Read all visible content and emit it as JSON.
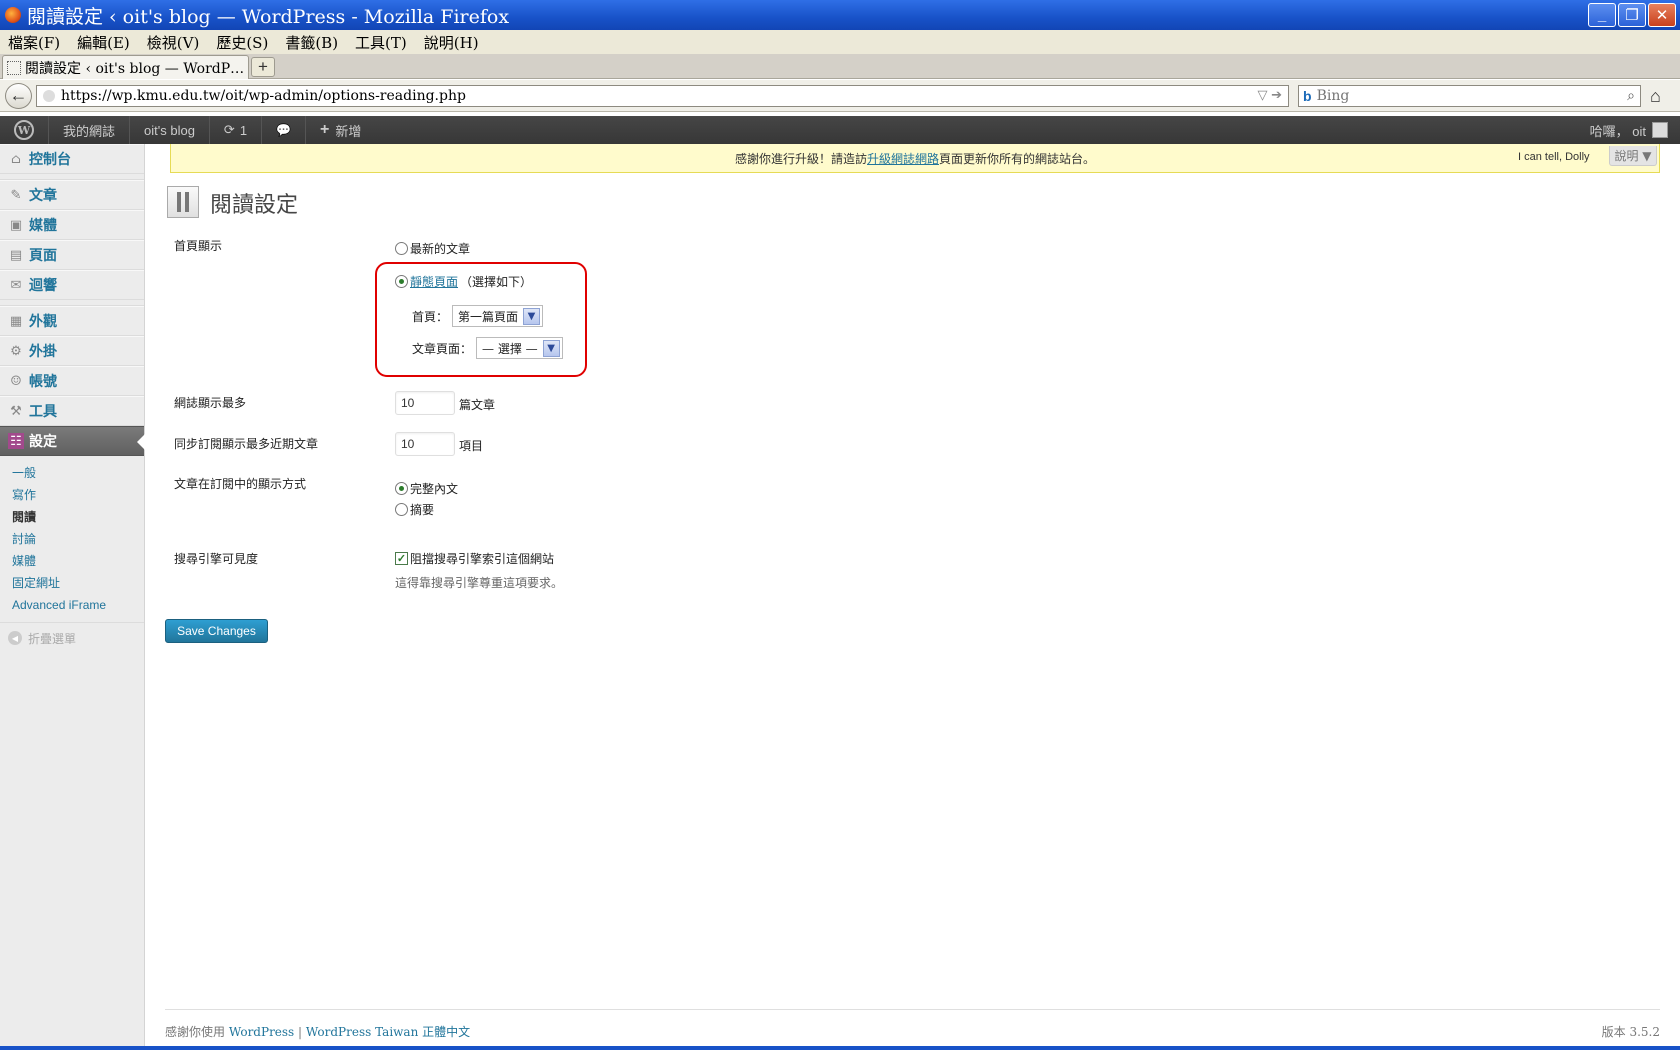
{
  "window": {
    "title": "閱讀設定 ‹ oit's blog — WordPress - Mozilla Firefox",
    "minimize": "_",
    "maximize": "❐",
    "close": "✕"
  },
  "menubar": [
    "檔案(F)",
    "編輯(E)",
    "檢視(V)",
    "歷史(S)",
    "書籤(B)",
    "工具(T)",
    "說明(H)"
  ],
  "tab": {
    "label": "閱讀設定 ‹ oit's blog — WordP…",
    "new_tab": "+"
  },
  "nav": {
    "back": "←",
    "url": "https://wp.kmu.edu.tw/oit/wp-admin/options-reading.php",
    "url_arrows": "▽ ➔",
    "search_engine": "b",
    "search_placeholder": "Bing",
    "search_icon": "⌕",
    "home_icon": "⌂"
  },
  "adminbar": {
    "wp_logo": "W",
    "my_sites": "我的網誌",
    "site_name": "oit's blog",
    "updates_icon": "⟳",
    "updates": "1",
    "comments_icon": "💬",
    "new_icon": "+",
    "new": "新增",
    "greeting": "哈囉， oit"
  },
  "sidebar": {
    "items": [
      {
        "icon": "⌂",
        "label": "控制台"
      },
      {
        "icon": "✎",
        "label": "文章"
      },
      {
        "icon": "▣",
        "label": "媒體"
      },
      {
        "icon": "▤",
        "label": "頁面"
      },
      {
        "icon": "✉",
        "label": "迴響"
      },
      {
        "icon": "▦",
        "label": "外觀"
      },
      {
        "icon": "⚙",
        "label": "外掛"
      },
      {
        "icon": "☺",
        "label": "帳號"
      },
      {
        "icon": "⚒",
        "label": "工具"
      },
      {
        "icon": "☷",
        "label": "設定"
      }
    ],
    "submenu": [
      "一般",
      "寫作",
      "閱讀",
      "討論",
      "媒體",
      "固定網址",
      "Advanced iFrame"
    ],
    "collapse_icon": "◀",
    "collapse": "折疊選單"
  },
  "notice": {
    "before": "感謝你進行升級！請造訪",
    "link": "升級網誌網路",
    "after": "頁面更新你所有的網誌站台。",
    "dolly": "I can tell, Dolly",
    "help": "說明 ▼"
  },
  "page": {
    "title": "閱讀設定",
    "front_page_label": "首頁顯示",
    "latest_posts": "最新的文章",
    "static_page_link": "靜態頁面",
    "static_page_hint": "（選擇如下）",
    "front_page_select_label": "首頁：",
    "front_page_select_value": "第一篇頁面",
    "posts_page_select_label": "文章頁面：",
    "posts_page_select_value": "— 選擇 —",
    "select_arrow": "▼",
    "blog_pages_label": "網誌顯示最多",
    "blog_pages_value": "10",
    "blog_pages_unit": "篇文章",
    "feed_label": "同步訂閱顯示最多近期文章",
    "feed_value": "10",
    "feed_unit": "項目",
    "feed_display_label": "文章在訂閱中的顯示方式",
    "full_text": "完整內文",
    "summary": "摘要",
    "search_visibility_label": "搜尋引擎可見度",
    "discourage_label": "阻擋搜尋引擎索引這個網站",
    "discourage_desc": "這得靠搜尋引擎尊重這項要求。",
    "checkmark": "✓",
    "save": "Save Changes"
  },
  "footer": {
    "thanks": "感謝你使用 ",
    "wordpress": "WordPress",
    "sep": " | ",
    "wp_taiwan": "WordPress Taiwan 正體中文",
    "version": "版本 3.5.2"
  }
}
